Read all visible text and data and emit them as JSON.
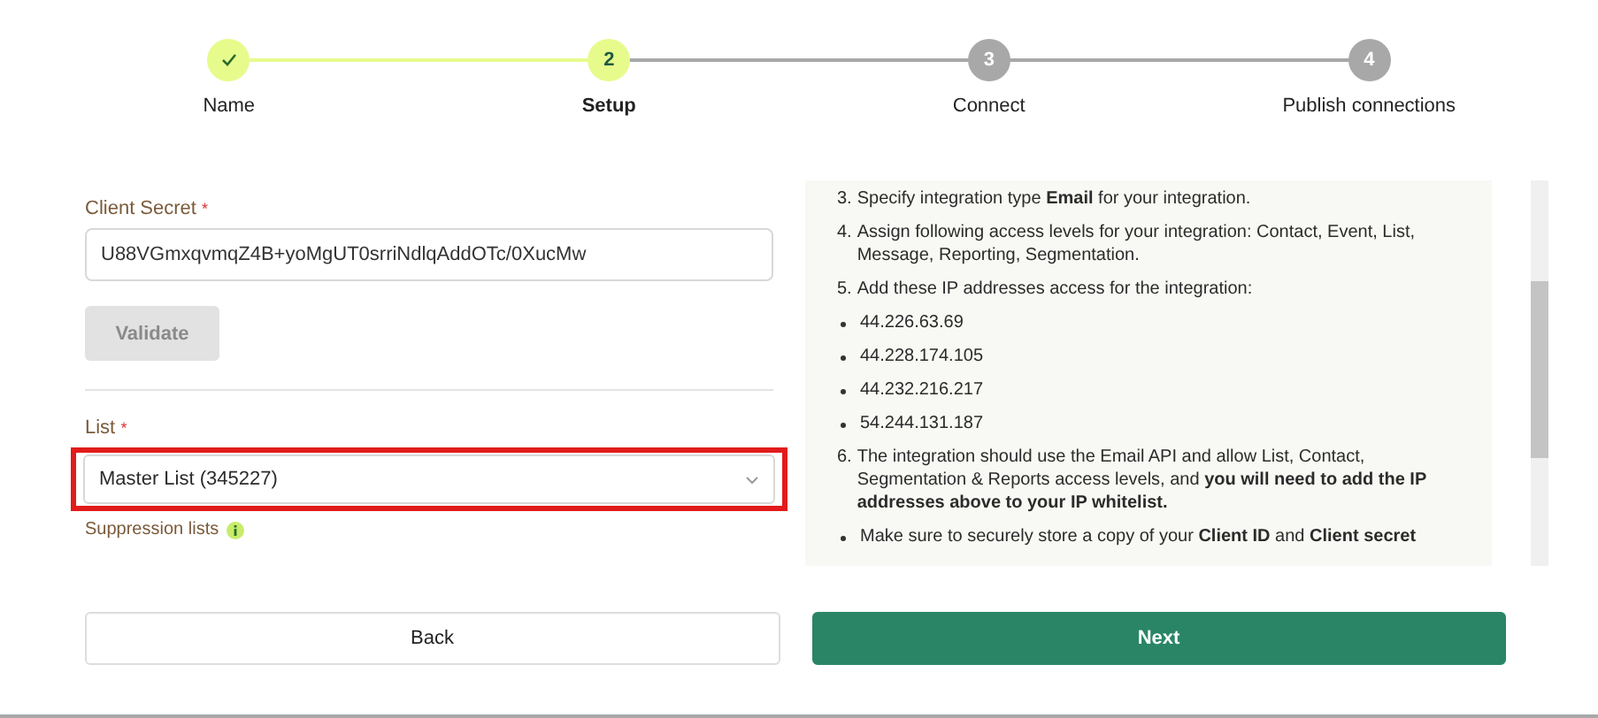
{
  "stepper": [
    {
      "label": "Name",
      "kind": "done"
    },
    {
      "number": "2",
      "label": "Setup",
      "kind": "current"
    },
    {
      "number": "3",
      "label": "Connect",
      "kind": "upcoming"
    },
    {
      "number": "4",
      "label": "Publish connections",
      "kind": "upcoming"
    }
  ],
  "form": {
    "client_secret": {
      "label": "Client Secret",
      "required_mark": "*",
      "value": "U88VGmxqvmqZ4B+yoMgUT0srriNdlqAddOTc/0XucMw"
    },
    "validate_button": {
      "label": "Validate",
      "disabled": true
    },
    "list": {
      "label": "List",
      "required_mark": "*",
      "value": "Master List (345227)",
      "highlighted": true
    },
    "suppression": {
      "label": "Suppression lists"
    }
  },
  "instructions": [
    {
      "number": "3.",
      "text": "Specify integration type **Email** for your integration."
    },
    {
      "number": "4.",
      "text": "Assign following access levels for your integration: Contact, Event, List, Message, Reporting, Segmentation."
    },
    {
      "number": "5.",
      "text": "Add these IP addresses access for the integration:",
      "bullets": [
        "44.226.63.69",
        "44.228.174.105",
        "44.232.216.217",
        "54.244.131.187"
      ]
    },
    {
      "number": "6.",
      "text": "The integration should use the Email API and allow List, Contact, Segmentation & Reports access levels, and **you will need to add the IP addresses above to your IP whitelist.**",
      "bullets": [
        "Make sure to securely store a copy of your **Client ID** and **Client secret**"
      ]
    }
  ],
  "footer": {
    "back": "Back",
    "next": "Next"
  }
}
